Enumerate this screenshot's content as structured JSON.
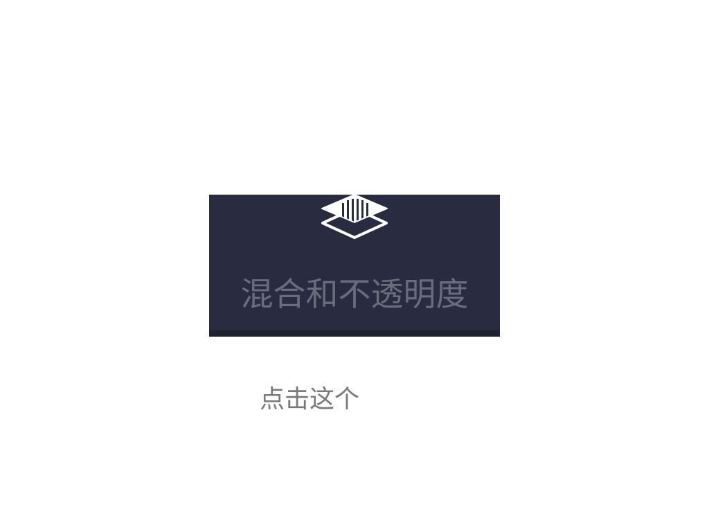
{
  "tool": {
    "label": "混合和不透明度",
    "icon": "layers-blend-icon",
    "colors": {
      "panel_background": "#292c40",
      "icon": "#ffffff",
      "label": "#6a6c7c"
    }
  },
  "hint": {
    "text": "点击这个",
    "color": "#7a7a7a"
  }
}
